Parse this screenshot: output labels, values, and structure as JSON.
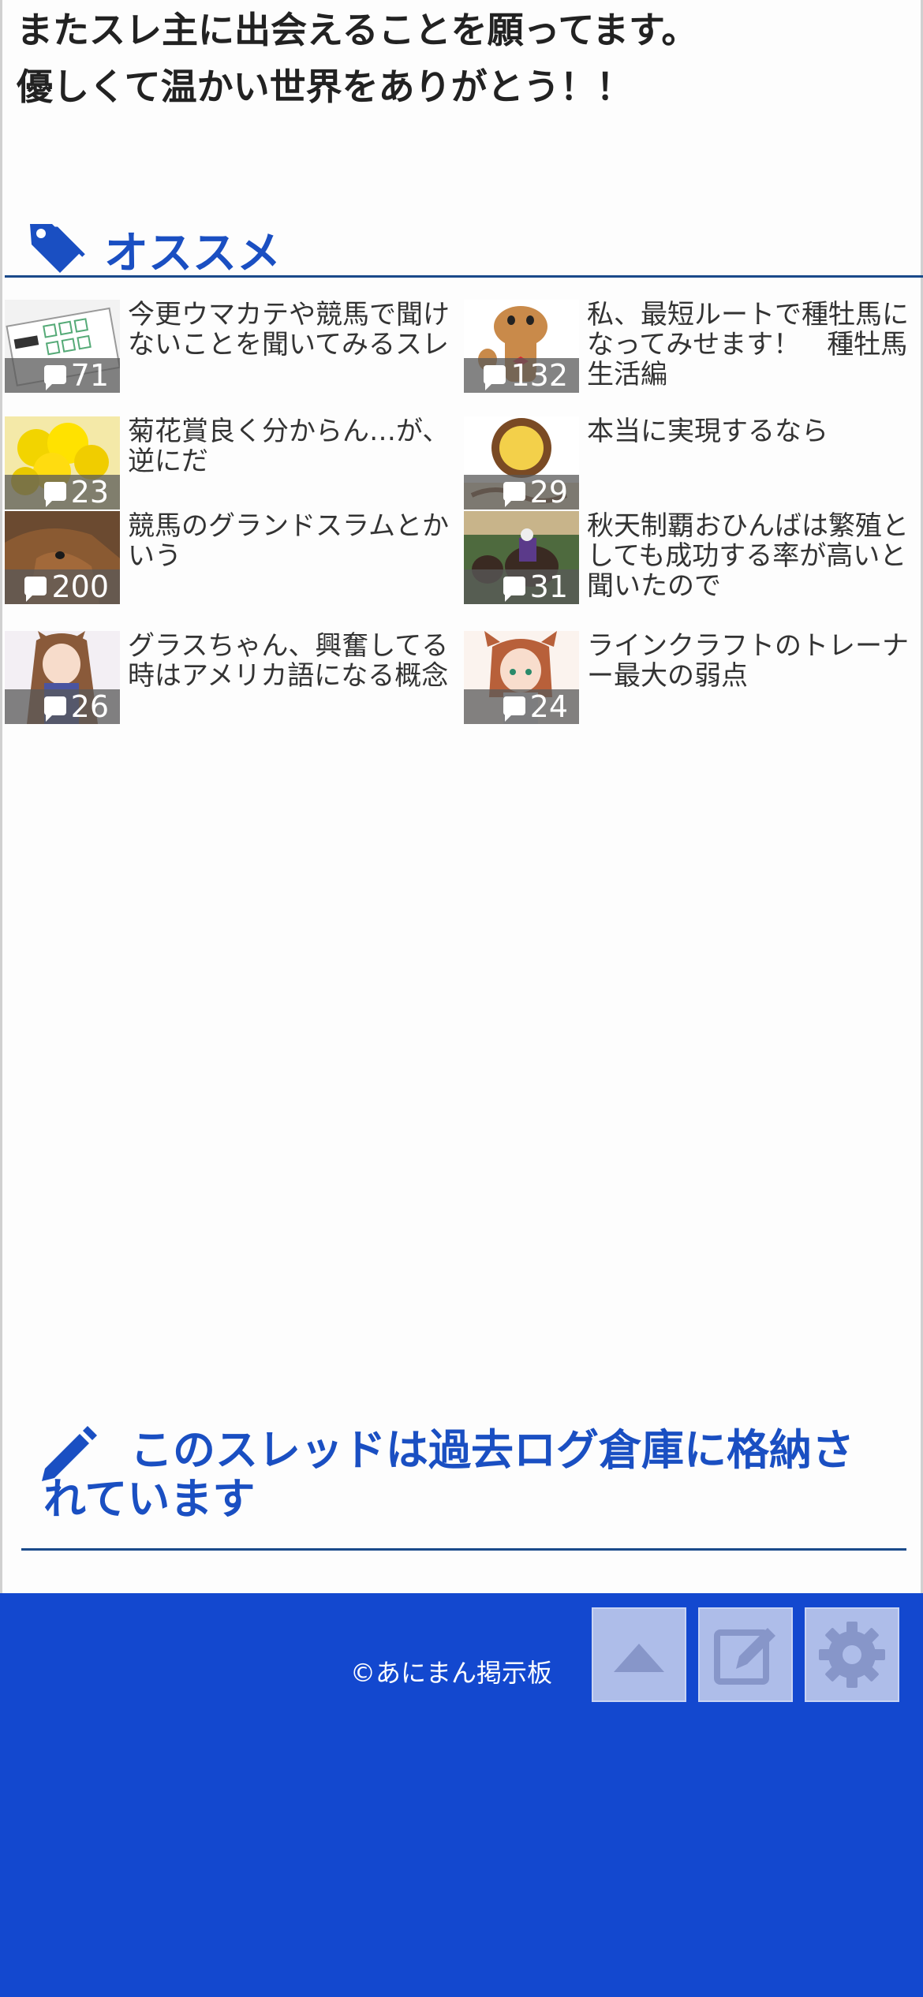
{
  "post": {
    "line1": "またスレ主に出会えることを願ってます。",
    "line2": "優しくて温かい世界をありがとう！！"
  },
  "recommend": {
    "title": "オススメ",
    "icon": "tag-icon",
    "items": [
      {
        "title": "今更ウマカテや競馬で聞けないことを聞いてみるスレ",
        "count": "71",
        "thumb": "race-card-thumbnail"
      },
      {
        "title": "私、最短ルートで種牡馬になってみせます！　種牡馬生活編",
        "count": "132",
        "thumb": "horse-illustration-thumbnail"
      },
      {
        "title": "菊花賞良く分からん…が、逆にだ",
        "count": "23",
        "thumb": "yellow-flowers-thumbnail"
      },
      {
        "title": "本当に実現するなら",
        "count": "29",
        "thumb": "coco-ichibanya-thumbnail"
      },
      {
        "title": "競馬のグランドスラムとかいう",
        "count": "200",
        "thumb": "horse-photo-thumbnail"
      },
      {
        "title": "秋天制覇おひんばは繁殖としても成功する率が高いと聞いたので",
        "count": "31",
        "thumb": "race-photo-thumbnail"
      },
      {
        "title": "グラスちゃん、興奮してる時はアメリカ語になる概念",
        "count": "26",
        "thumb": "anime-girl-thumbnail"
      },
      {
        "title": "ラインクラフトのトレーナー最大の弱点",
        "count": "24",
        "thumb": "anime-girl-thumbnail"
      }
    ]
  },
  "archived": {
    "message": "このスレッドは過去ログ倉庫に格納されています",
    "icon": "pencil-icon"
  },
  "footer": {
    "copyright": "©あにまん掲示板",
    "buttons": [
      "scroll-top-button",
      "compose-button",
      "settings-button"
    ],
    "bg_color": "#1348cf"
  },
  "colors": {
    "accent": "#1a4fc2",
    "rule": "#1a4a8a"
  }
}
